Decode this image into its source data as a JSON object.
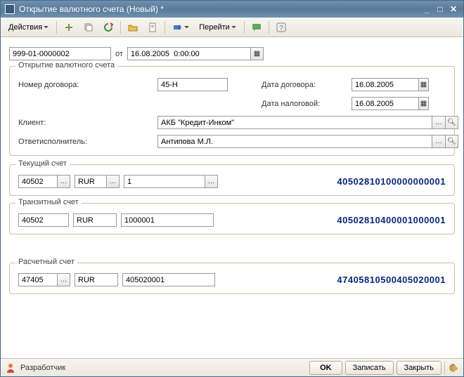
{
  "window": {
    "title": "Открытие валютного счета (Новый) *"
  },
  "toolbar": {
    "actions": "Действия",
    "goto": "Перейти"
  },
  "top": {
    "number": "999-01-0000002",
    "from_label": "от",
    "date": "16.08.2005  0:00:00"
  },
  "opening": {
    "legend": "Открытие валютного счета",
    "contract_num_label": "Номер договора:",
    "contract_num": "45-Н",
    "contract_date_label": "Дата договора:",
    "contract_date": "16.08.2005",
    "tax_date_label": "Дата налоговой:",
    "tax_date": "16.08.2005",
    "client_label": "Клиент:",
    "client": "АКБ \"Кредит-Инком\"",
    "responsible_label": "Ответисполнитель:",
    "responsible": "Антипова М.Л."
  },
  "current": {
    "legend": "Текущий счет",
    "code": "40502",
    "currency": "RUR",
    "seq": "1",
    "full": "40502810100000000001"
  },
  "transit": {
    "legend": "Транзитный счет",
    "code": "40502",
    "currency": "RUR",
    "seq": "1000001",
    "full": "40502810400001000001"
  },
  "settlement": {
    "legend": "Расчетный счет",
    "code": "47405",
    "currency": "RUR",
    "seq": "405020001",
    "full": "47405810500405020001"
  },
  "status": {
    "developer": "Разработчик",
    "ok": "OK",
    "write": "Записать",
    "close": "Закрыть"
  }
}
